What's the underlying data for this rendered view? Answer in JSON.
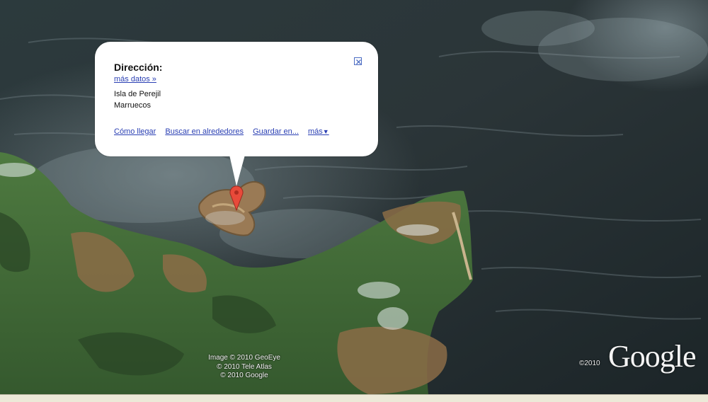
{
  "map": {
    "view": "satellite",
    "colors": {
      "sea_dark": "#1f2a2e",
      "sea_mid": "#3d4a4f",
      "land_green": "#3e6a35",
      "land_brown": "#8a6a45",
      "island": "#9a7a56"
    }
  },
  "infowindow": {
    "title": "Dirección:",
    "more_data": "más datos »",
    "place_name": "Isla de Perejil",
    "country": "Marruecos",
    "close_icon": "close-icon",
    "links": {
      "directions": "Cómo llegar",
      "search_nearby": "Buscar en alrededores",
      "save_to": "Guardar en...",
      "more": "más",
      "more_arrow": "▼"
    }
  },
  "marker": {
    "icon": "location-pin-icon",
    "color": "#e84a3a"
  },
  "attribution": {
    "line1": "Image © 2010 GeoEye",
    "line2": "© 2010 Tele Atlas",
    "line3": "© 2010 Google"
  },
  "copyright": {
    "year": "©2010"
  },
  "logo": {
    "text": "Google"
  }
}
